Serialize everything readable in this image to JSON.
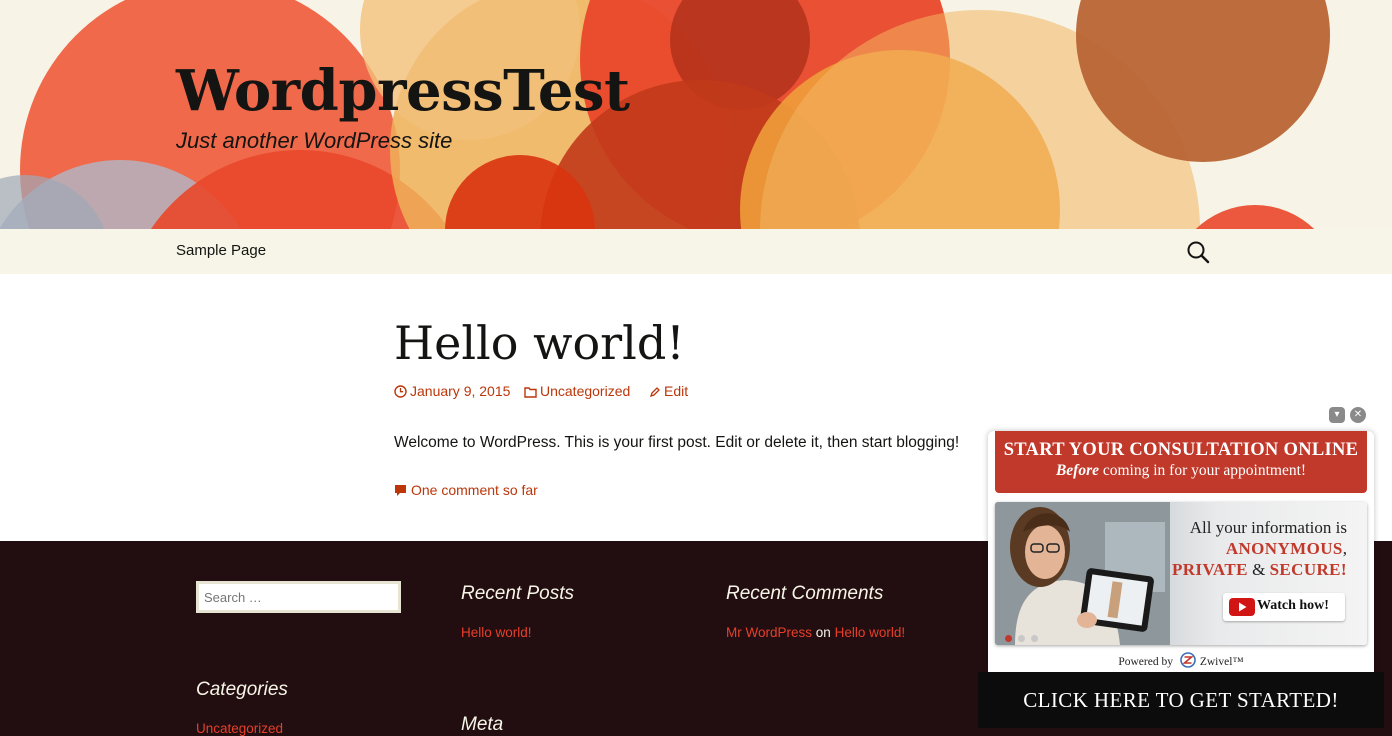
{
  "header": {
    "site_title": "WordpressTest",
    "site_description": "Just another WordPress site"
  },
  "nav": {
    "items": [
      {
        "label": "Sample Page"
      }
    ],
    "search_icon": "search-icon"
  },
  "post": {
    "title": "Hello world!",
    "date": "January 9, 2015",
    "category": "Uncategorized",
    "edit_label": "Edit",
    "content": "Welcome to WordPress. This is your first post. Edit or delete it, then start blogging!",
    "comments_label": "One comment so far"
  },
  "footer": {
    "search_placeholder": "Search …",
    "recent_posts": {
      "title": "Recent Posts",
      "items": [
        "Hello world!"
      ]
    },
    "recent_comments": {
      "title": "Recent Comments",
      "author": "Mr WordPress",
      "connector": "on",
      "post": "Hello world!"
    },
    "categories": {
      "title": "Categories",
      "items": [
        "Uncategorized"
      ]
    },
    "meta": {
      "title": "Meta"
    }
  },
  "ad": {
    "minimize_icon": "▾",
    "close_icon": "✕",
    "headline": "START YOUR CONSULTATION ONLINE",
    "sub_emphasis": "Before",
    "sub_rest": "coming in for your appointment!",
    "copy_line1": "All your information is",
    "copy_anonymous": "ANONYMOUS",
    "copy_comma": ",",
    "copy_private": "PRIVATE",
    "copy_amp": "&",
    "copy_secure": "SECURE!",
    "watch_label": "Watch how!",
    "powered_by": "Powered by",
    "brand": "Zwivel™",
    "cta": "CLICK HERE TO GET STARTED!"
  },
  "colors": {
    "accent": "#bc360a",
    "header_bg": "#f7f3e6",
    "footer_bg": "#220e10",
    "ad_red": "#c0392b"
  }
}
